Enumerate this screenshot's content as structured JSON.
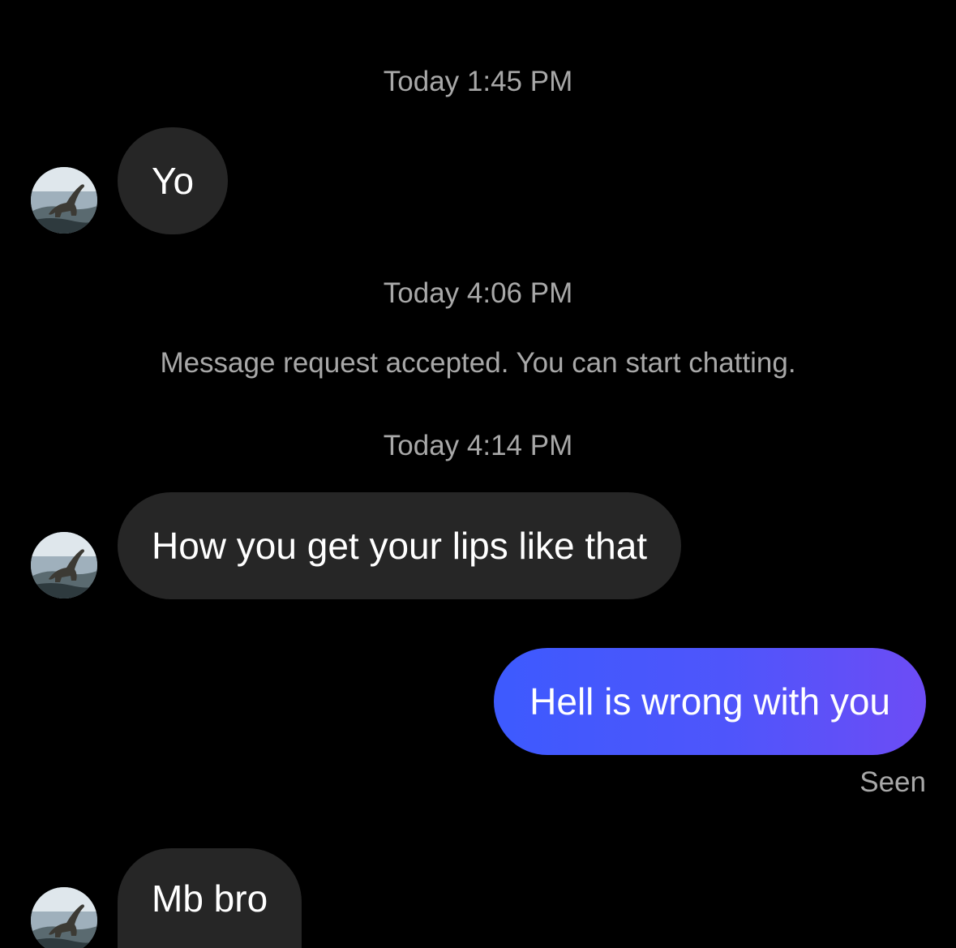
{
  "conversation": {
    "timestamps": [
      "Today 1:45 PM",
      "Today 4:06 PM",
      "Today 4:14 PM"
    ],
    "system_note": "Message request accepted. You can start chatting.",
    "messages": [
      {
        "sender": "them",
        "text": "Yo"
      },
      {
        "sender": "them",
        "text": "How you get your lips like that"
      },
      {
        "sender": "me",
        "text": "Hell is wrong with you"
      },
      {
        "sender": "them",
        "text": "Mb bro"
      }
    ],
    "seen_label": "Seen"
  },
  "colors": {
    "background": "#000000",
    "incoming_bubble": "#262626",
    "outgoing_gradient_start": "#3d5afe",
    "outgoing_gradient_end": "#6d4cf5",
    "meta_text": "#a8a8a8"
  },
  "icons": {
    "avatar": "dinosaur-profile-avatar"
  }
}
